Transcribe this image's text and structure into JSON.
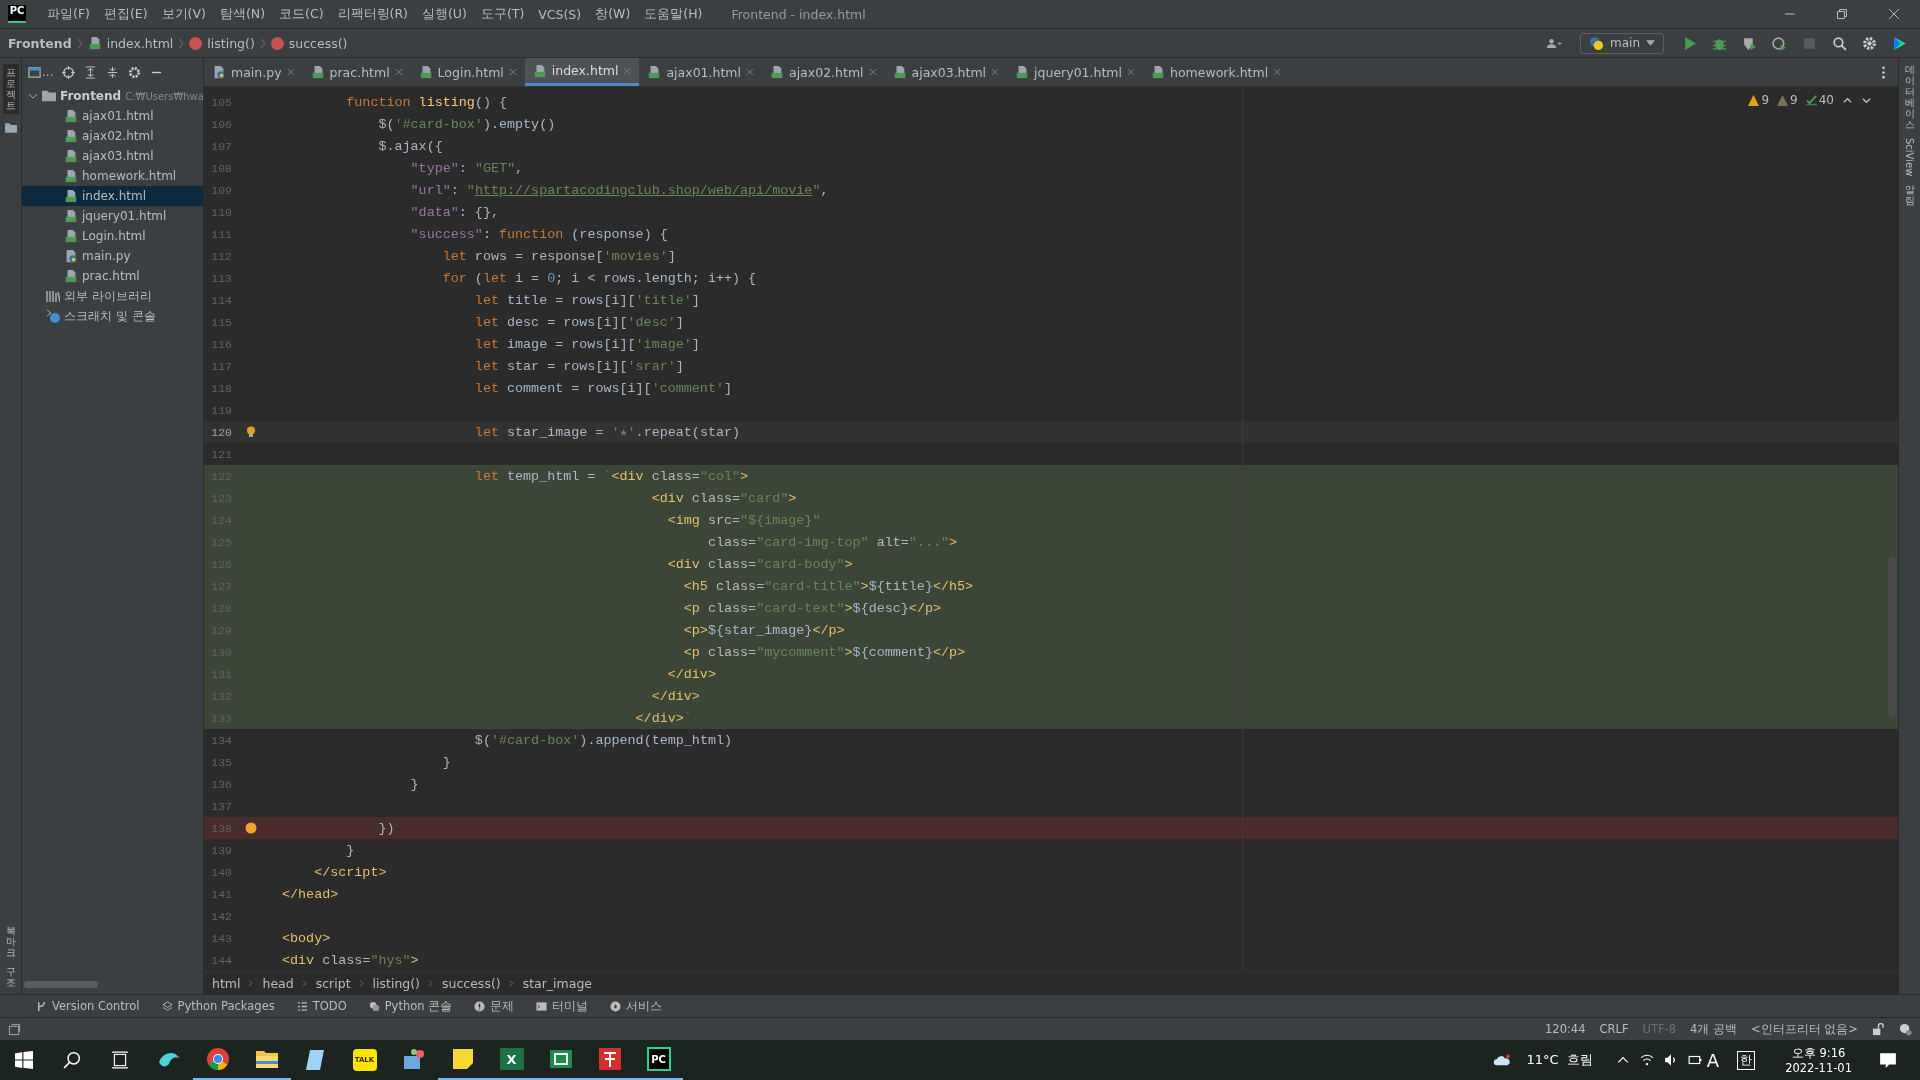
{
  "app": {
    "logo_text": "PC",
    "menu": [
      "파일(F)",
      "편집(E)",
      "보기(V)",
      "탐색(N)",
      "코드(C)",
      "리팩터링(R)",
      "실행(U)",
      "도구(T)",
      "VCS(S)",
      "창(W)",
      "도움말(H)"
    ],
    "title": "Frontend - index.html"
  },
  "nav": {
    "breadcrumbs": [
      {
        "kind": "project",
        "label": "Frontend"
      },
      {
        "kind": "html",
        "label": "index.html"
      },
      {
        "kind": "function",
        "label": "listing()"
      },
      {
        "kind": "method",
        "label": "success()"
      }
    ],
    "run_config": "main"
  },
  "side_labels": {
    "left_top": "프로젝트",
    "left_bottom": [
      "북마크",
      "구조"
    ],
    "right": [
      {
        "kind": "cjk",
        "label": "데이터베이스"
      },
      {
        "kind": "latin",
        "label": "SciView"
      },
      {
        "kind": "cjk",
        "label": "알림"
      }
    ]
  },
  "project": {
    "toolbar_label": "...",
    "root": {
      "name": "Frontend",
      "path": "C:₩Users₩hwa",
      "expanded": true,
      "children": [
        {
          "kind": "html",
          "name": "ajax01.html",
          "selected": false
        },
        {
          "kind": "html",
          "name": "ajax02.html",
          "selected": false
        },
        {
          "kind": "html",
          "name": "ajax03.html",
          "selected": false
        },
        {
          "kind": "html",
          "name": "homework.html",
          "selected": false
        },
        {
          "kind": "html",
          "name": "index.html",
          "selected": true
        },
        {
          "kind": "html",
          "name": "jquery01.html",
          "selected": false
        },
        {
          "kind": "html",
          "name": "Login.html",
          "selected": false
        },
        {
          "kind": "py",
          "name": "main.py",
          "selected": false
        },
        {
          "kind": "html",
          "name": "prac.html",
          "selected": false
        }
      ]
    },
    "extra": [
      {
        "kind": "library",
        "name": "외부 라이브러리"
      },
      {
        "kind": "scratch",
        "name": "스크래치 및 콘솔"
      }
    ]
  },
  "tabs": [
    {
      "kind": "py",
      "label": "main.py",
      "selected": false
    },
    {
      "kind": "html",
      "label": "prac.html",
      "selected": false
    },
    {
      "kind": "html",
      "label": "Login.html",
      "selected": false
    },
    {
      "kind": "html",
      "label": "index.html",
      "selected": true
    },
    {
      "kind": "html",
      "label": "ajax01.html",
      "selected": false
    },
    {
      "kind": "html",
      "label": "ajax02.html",
      "selected": false
    },
    {
      "kind": "html",
      "label": "ajax03.html",
      "selected": false
    },
    {
      "kind": "html",
      "label": "jquery01.html",
      "selected": false
    },
    {
      "kind": "html",
      "label": "homework.html",
      "selected": false
    }
  ],
  "inspections": [
    {
      "kind": "warning",
      "count": "9"
    },
    {
      "kind": "weak",
      "count": "9"
    },
    {
      "kind": "typo",
      "count": "40"
    }
  ],
  "code": [
    {
      "n": "105",
      "kind": "plain",
      "tokens": [
        {
          "kind": "kw",
          "text": "        function"
        },
        {
          "kind": "fn",
          "text": " listing"
        },
        {
          "kind": "p",
          "text": "() {"
        }
      ]
    },
    {
      "n": "106",
      "kind": "plain",
      "tokens": [
        {
          "kind": "p",
          "text": "            $("
        },
        {
          "kind": "str",
          "text": "'#card-box'"
        },
        {
          "kind": "p",
          "text": ").empty()"
        }
      ]
    },
    {
      "n": "107",
      "kind": "plain",
      "tokens": [
        {
          "kind": "p",
          "text": "            $.ajax({"
        }
      ]
    },
    {
      "n": "108",
      "kind": "plain",
      "tokens": [
        {
          "kind": "prop",
          "text": "                \"type\""
        },
        {
          "kind": "p",
          "text": ": "
        },
        {
          "kind": "str",
          "text": "\"GET\""
        },
        {
          "kind": "p",
          "text": ","
        }
      ]
    },
    {
      "n": "109",
      "kind": "plain",
      "tokens": [
        {
          "kind": "prop",
          "text": "                \"url\""
        },
        {
          "kind": "p",
          "text": ": "
        },
        {
          "kind": "str",
          "text": "\""
        },
        {
          "kind": "url",
          "text": "http://spartacodingclub.shop/web/api/movie"
        },
        {
          "kind": "str",
          "text": "\""
        },
        {
          "kind": "p",
          "text": ","
        }
      ]
    },
    {
      "n": "110",
      "kind": "plain",
      "tokens": [
        {
          "kind": "prop",
          "text": "                \"data\""
        },
        {
          "kind": "p",
          "text": ": {},"
        }
      ]
    },
    {
      "n": "111",
      "kind": "plain",
      "tokens": [
        {
          "kind": "prop",
          "text": "                \"success\""
        },
        {
          "kind": "p",
          "text": ": "
        },
        {
          "kind": "kw",
          "text": "function"
        },
        {
          "kind": "p",
          "text": " (response) {"
        }
      ]
    },
    {
      "n": "112",
      "kind": "plain",
      "tokens": [
        {
          "kind": "kw",
          "text": "                    let"
        },
        {
          "kind": "p",
          "text": " rows = response["
        },
        {
          "kind": "str",
          "text": "'movies'"
        },
        {
          "kind": "p",
          "text": "]"
        }
      ]
    },
    {
      "n": "113",
      "kind": "plain",
      "tokens": [
        {
          "kind": "kw",
          "text": "                    for"
        },
        {
          "kind": "p",
          "text": " ("
        },
        {
          "kind": "kw",
          "text": "let"
        },
        {
          "kind": "p",
          "text": " i = "
        },
        {
          "kind": "num",
          "text": "0"
        },
        {
          "kind": "p",
          "text": "; i < rows.length; i++) {"
        }
      ]
    },
    {
      "n": "114",
      "kind": "plain",
      "tokens": [
        {
          "kind": "kw",
          "text": "                        let"
        },
        {
          "kind": "p",
          "text": " title = rows[i]["
        },
        {
          "kind": "str",
          "text": "'title'"
        },
        {
          "kind": "p",
          "text": "]"
        }
      ]
    },
    {
      "n": "115",
      "kind": "plain",
      "tokens": [
        {
          "kind": "kw",
          "text": "                        let"
        },
        {
          "kind": "p",
          "text": " desc = rows[i]["
        },
        {
          "kind": "str",
          "text": "'desc'"
        },
        {
          "kind": "p",
          "text": "]"
        }
      ]
    },
    {
      "n": "116",
      "kind": "plain",
      "tokens": [
        {
          "kind": "kw",
          "text": "                        let"
        },
        {
          "kind": "p",
          "text": " image = rows[i]["
        },
        {
          "kind": "str",
          "text": "'image'"
        },
        {
          "kind": "p",
          "text": "]"
        }
      ]
    },
    {
      "n": "117",
      "kind": "plain",
      "tokens": [
        {
          "kind": "kw",
          "text": "                        let"
        },
        {
          "kind": "p",
          "text": " star = rows[i]["
        },
        {
          "kind": "str",
          "text": "'srar'"
        },
        {
          "kind": "p",
          "text": "]"
        }
      ]
    },
    {
      "n": "118",
      "kind": "plain",
      "tokens": [
        {
          "kind": "kw",
          "text": "                        let"
        },
        {
          "kind": "p",
          "text": " comment = rows[i]["
        },
        {
          "kind": "str",
          "text": "'comment'"
        },
        {
          "kind": "p",
          "text": "]"
        }
      ]
    },
    {
      "n": "119",
      "kind": "plain"
    },
    {
      "n": "120",
      "kind": "current",
      "tokens": [
        {
          "kind": "kw",
          "text": "                        let"
        },
        {
          "kind": "p",
          "text": " star_image = "
        },
        {
          "kind": "str",
          "text": "'★'"
        },
        {
          "kind": "p",
          "text": ".repeat(star)"
        }
      ]
    },
    {
      "n": "121",
      "kind": "plain"
    },
    {
      "n": "122",
      "kind": "template",
      "tokens": [
        {
          "kind": "kw",
          "text": "                        let"
        },
        {
          "kind": "p",
          "text": " temp_html = "
        },
        {
          "kind": "str",
          "text": "`"
        },
        {
          "kind": "tag",
          "text": "<div "
        },
        {
          "kind": "attr",
          "text": "class"
        },
        {
          "kind": "p",
          "text": "="
        },
        {
          "kind": "str",
          "text": "\"col\""
        },
        {
          "kind": "tag",
          "text": ">"
        }
      ]
    },
    {
      "n": "123",
      "kind": "template",
      "tokens": [
        {
          "kind": "tag",
          "text": "                                              <div "
        },
        {
          "kind": "attr",
          "text": "class"
        },
        {
          "kind": "p",
          "text": "="
        },
        {
          "kind": "str",
          "text": "\"card\""
        },
        {
          "kind": "tag",
          "text": ">"
        }
      ]
    },
    {
      "n": "124",
      "kind": "template",
      "tokens": [
        {
          "kind": "tag",
          "text": "                                                <img "
        },
        {
          "kind": "attr",
          "text": "src"
        },
        {
          "kind": "p",
          "text": "="
        },
        {
          "kind": "str",
          "text": "\"${image}\""
        }
      ]
    },
    {
      "n": "125",
      "kind": "template",
      "tokens": [
        {
          "kind": "attr",
          "text": "                                                     class"
        },
        {
          "kind": "p",
          "text": "="
        },
        {
          "kind": "str",
          "text": "\"card-img-top\""
        },
        {
          "kind": "attr",
          "text": " alt"
        },
        {
          "kind": "p",
          "text": "="
        },
        {
          "kind": "str",
          "text": "\"...\""
        },
        {
          "kind": "tag",
          "text": ">"
        }
      ]
    },
    {
      "n": "126",
      "kind": "template",
      "tokens": [
        {
          "kind": "tag",
          "text": "                                                <div "
        },
        {
          "kind": "attr",
          "text": "class"
        },
        {
          "kind": "p",
          "text": "="
        },
        {
          "kind": "str",
          "text": "\"card-body\""
        },
        {
          "kind": "tag",
          "text": ">"
        }
      ]
    },
    {
      "n": "127",
      "kind": "template",
      "tokens": [
        {
          "kind": "tag",
          "text": "                                                  <h5 "
        },
        {
          "kind": "attr",
          "text": "class"
        },
        {
          "kind": "p",
          "text": "="
        },
        {
          "kind": "str",
          "text": "\"card-title\""
        },
        {
          "kind": "tag",
          "text": ">"
        },
        {
          "kind": "p",
          "text": "${title}"
        },
        {
          "kind": "tag",
          "text": "</h5>"
        }
      ]
    },
    {
      "n": "128",
      "kind": "template",
      "tokens": [
        {
          "kind": "tag",
          "text": "                                                  <p "
        },
        {
          "kind": "attr",
          "text": "class"
        },
        {
          "kind": "p",
          "text": "="
        },
        {
          "kind": "str",
          "text": "\"card-text\""
        },
        {
          "kind": "tag",
          "text": ">"
        },
        {
          "kind": "p",
          "text": "${desc}"
        },
        {
          "kind": "tag",
          "text": "</p>"
        }
      ]
    },
    {
      "n": "129",
      "kind": "template",
      "tokens": [
        {
          "kind": "tag",
          "text": "                                                  <p>"
        },
        {
          "kind": "p",
          "text": "${star_image}"
        },
        {
          "kind": "tag",
          "text": "</p>"
        }
      ]
    },
    {
      "n": "130",
      "kind": "template",
      "tokens": [
        {
          "kind": "tag",
          "text": "                                                  <p "
        },
        {
          "kind": "attr",
          "text": "class"
        },
        {
          "kind": "p",
          "text": "="
        },
        {
          "kind": "str",
          "text": "\"mycomment\""
        },
        {
          "kind": "tag",
          "text": ">"
        },
        {
          "kind": "p",
          "text": "${comment}"
        },
        {
          "kind": "tag",
          "text": "</p>"
        }
      ]
    },
    {
      "n": "131",
      "kind": "template",
      "tokens": [
        {
          "kind": "tag",
          "text": "                                                </div>"
        }
      ]
    },
    {
      "n": "132",
      "kind": "template",
      "tokens": [
        {
          "kind": "tag",
          "text": "                                              </div>"
        }
      ]
    },
    {
      "n": "133",
      "kind": "template",
      "tokens": [
        {
          "kind": "tag",
          "text": "                                            </div>"
        },
        {
          "kind": "str",
          "text": "`"
        }
      ]
    },
    {
      "n": "134",
      "kind": "plain",
      "tokens": [
        {
          "kind": "p",
          "text": "                        $("
        },
        {
          "kind": "str",
          "text": "'#card-box'"
        },
        {
          "kind": "p",
          "text": ").append(temp_html)"
        }
      ]
    },
    {
      "n": "135",
      "kind": "plain",
      "tokens": [
        {
          "kind": "p",
          "text": "                    }"
        }
      ]
    },
    {
      "n": "136",
      "kind": "plain",
      "tokens": [
        {
          "kind": "p",
          "text": "                }"
        }
      ]
    },
    {
      "n": "137",
      "kind": "plain"
    },
    {
      "n": "138",
      "kind": "breakpoint",
      "tokens": [
        {
          "kind": "p",
          "text": "            })"
        }
      ]
    },
    {
      "n": "139",
      "kind": "plain",
      "tokens": [
        {
          "kind": "p",
          "text": "        }"
        }
      ]
    },
    {
      "n": "140",
      "kind": "plain",
      "tokens": [
        {
          "kind": "tag",
          "text": "    </script>"
        }
      ]
    },
    {
      "n": "141",
      "kind": "plain",
      "tokens": [
        {
          "kind": "tag",
          "text": "</head>"
        }
      ]
    },
    {
      "n": "142",
      "kind": "plain"
    },
    {
      "n": "143",
      "kind": "plain",
      "tokens": [
        {
          "kind": "tag",
          "text": "<body>"
        }
      ]
    },
    {
      "n": "144",
      "kind": "plain",
      "tokens": [
        {
          "kind": "tag",
          "text": "<div "
        },
        {
          "kind": "attr",
          "text": "class"
        },
        {
          "kind": "p",
          "text": "="
        },
        {
          "kind": "str",
          "text": "\"hys\""
        },
        {
          "kind": "tag",
          "text": ">"
        }
      ]
    }
  ],
  "code_path": [
    "html",
    "head",
    "script",
    "listing()",
    "success()",
    "star_image"
  ],
  "tool_windows": [
    {
      "kind": "vcs",
      "label": "Version Control"
    },
    {
      "kind": "packages",
      "label": "Python Packages"
    },
    {
      "kind": "todo",
      "label": "TODO"
    },
    {
      "kind": "python",
      "label": "Python 콘솔"
    },
    {
      "kind": "problems",
      "label": "문제"
    },
    {
      "kind": "terminal",
      "label": "터미널"
    },
    {
      "kind": "services",
      "label": "서비스"
    }
  ],
  "status": [
    {
      "label": "120:44",
      "dim": false
    },
    {
      "label": "CRLF",
      "dim": false
    },
    {
      "label": "UTF-8",
      "dim": true
    },
    {
      "label": "4개 공백",
      "dim": false
    },
    {
      "label": "<인터프리터 없음>",
      "dim": false
    }
  ],
  "taskbar": {
    "apps": [
      {
        "kind": "whale",
        "active": false
      },
      {
        "kind": "chrome",
        "active": true
      },
      {
        "kind": "folder",
        "active": true
      },
      {
        "kind": "notepad",
        "active": false
      },
      {
        "kind": "talk",
        "label": "TALK",
        "active": false
      },
      {
        "kind": "paint",
        "active": false
      },
      {
        "kind": "sticky",
        "active": true
      },
      {
        "kind": "excel",
        "label": "X",
        "active": true
      },
      {
        "kind": "sheet",
        "active": true
      },
      {
        "kind": "pdf",
        "active": true
      },
      {
        "kind": "pycharm",
        "label": "PC",
        "active": true
      }
    ],
    "weather": "11°C  흐림",
    "ime_mode": "A",
    "ime_lang": "한",
    "time": "오후 9:16",
    "date": "2022-11-01"
  }
}
